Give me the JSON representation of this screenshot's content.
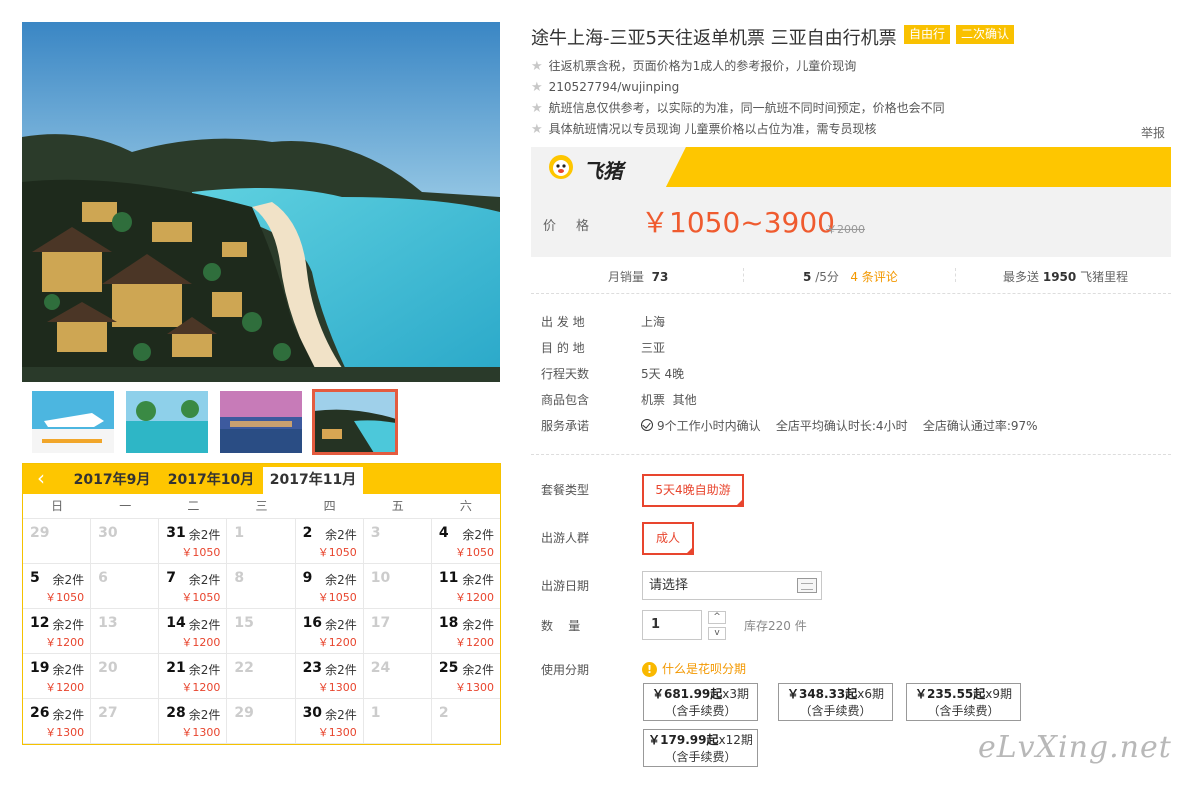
{
  "product": {
    "title": "途牛上海-三亚5天往返单机票 三亚自由行机票",
    "tags": [
      "自由行",
      "二次确认"
    ],
    "notes": [
      "往返机票含税，页面价格为1成人的参考报价，儿童价现询",
      "210527794/wujinping",
      "航班信息仅供参考，以实际的为准，同一航班不同时间预定，价格也会不同",
      "具体航班情况以专员现询 儿童票价格以占位为准，需专员现核"
    ],
    "report": "举报"
  },
  "brand": {
    "name": "飞猪"
  },
  "price": {
    "label": "价格",
    "current": "￥1050~3900",
    "original": "￥2000"
  },
  "stats": {
    "monthly_sales_label": "月销量",
    "monthly_sales": "73",
    "rating": "5",
    "rating_suffix": "/5分",
    "reviews": "4 条评论",
    "points_prefix": "最多送",
    "points": "1950",
    "points_suffix": "飞猪里程"
  },
  "specs": [
    {
      "k": "出 发 地",
      "v": "上海"
    },
    {
      "k": "目 的 地",
      "v": "三亚"
    },
    {
      "k": "行程天数",
      "v": "5天 4晚"
    },
    {
      "k": "商品包含",
      "v": "机票  其他"
    },
    {
      "k": "服务承诺",
      "v": "9个工作小时内确认    全店平均确认时长:4小时    全店确认通过率:97%"
    }
  ],
  "options": {
    "package_label": "套餐类型",
    "package_value": "5天4晚自助游",
    "crowd_label": "出游人群",
    "crowd_value": "成人",
    "date_label": "出游日期",
    "date_value": "请选择",
    "qty_label": "数    量",
    "qty_value": "1",
    "qty_up": "^",
    "qty_down": "v",
    "stock": "库存220 件",
    "installment_label": "使用分期",
    "installment_tip": "什么是花呗分期",
    "installments": [
      {
        "amount": "￥681.99起",
        "periods": "x3期",
        "fee": "（含手续费）"
      },
      {
        "amount": "￥348.33起",
        "periods": "x6期",
        "fee": "（含手续费）"
      },
      {
        "amount": "￥235.55起",
        "periods": "x9期",
        "fee": "（含手续费）"
      },
      {
        "amount": "￥179.99起",
        "periods": "x12期",
        "fee": "（含手续费）"
      }
    ]
  },
  "calendar": {
    "prev": "‹",
    "tabs": [
      "2017年9月",
      "2017年10月",
      "2017年11月"
    ],
    "active_tab": 2,
    "weekdays": [
      "日",
      "一",
      "二",
      "三",
      "四",
      "五",
      "六"
    ],
    "days": [
      {
        "d": "29",
        "off": true
      },
      {
        "d": "30",
        "off": true
      },
      {
        "d": "31",
        "s": "余2件",
        "p": "￥1050"
      },
      {
        "d": "1",
        "off": true
      },
      {
        "d": "2",
        "s": "余2件",
        "p": "￥1050"
      },
      {
        "d": "3",
        "off": true
      },
      {
        "d": "4",
        "s": "余2件",
        "p": "￥1050"
      },
      {
        "d": "5",
        "s": "余2件",
        "p": "￥1050"
      },
      {
        "d": "6",
        "off": true
      },
      {
        "d": "7",
        "s": "余2件",
        "p": "￥1050"
      },
      {
        "d": "8",
        "off": true
      },
      {
        "d": "9",
        "s": "余2件",
        "p": "￥1050"
      },
      {
        "d": "10",
        "off": true
      },
      {
        "d": "11",
        "s": "余2件",
        "p": "￥1200"
      },
      {
        "d": "12",
        "s": "余2件",
        "p": "￥1200"
      },
      {
        "d": "13",
        "off": true
      },
      {
        "d": "14",
        "s": "余2件",
        "p": "￥1200"
      },
      {
        "d": "15",
        "off": true
      },
      {
        "d": "16",
        "s": "余2件",
        "p": "￥1200"
      },
      {
        "d": "17",
        "off": true
      },
      {
        "d": "18",
        "s": "余2件",
        "p": "￥1200"
      },
      {
        "d": "19",
        "s": "余2件",
        "p": "￥1200"
      },
      {
        "d": "20",
        "off": true
      },
      {
        "d": "21",
        "s": "余2件",
        "p": "￥1200"
      },
      {
        "d": "22",
        "off": true
      },
      {
        "d": "23",
        "s": "余2件",
        "p": "￥1300"
      },
      {
        "d": "24",
        "off": true
      },
      {
        "d": "25",
        "s": "余2件",
        "p": "￥1300"
      },
      {
        "d": "26",
        "s": "余2件",
        "p": "￥1300"
      },
      {
        "d": "27",
        "off": true
      },
      {
        "d": "28",
        "s": "余2件",
        "p": "￥1300"
      },
      {
        "d": "29",
        "off": true
      },
      {
        "d": "30",
        "s": "余2件",
        "p": "￥1300"
      },
      {
        "d": "1",
        "off": true
      },
      {
        "d": "2",
        "off": true
      }
    ]
  },
  "gallery": {
    "thumb_count": 4,
    "active_thumb": 3
  },
  "watermark": "eLvXing.net",
  "colors": {
    "accent": "#fec600",
    "price": "#ef5b2f",
    "highlight": "#e8452e",
    "link": "#f39800"
  }
}
